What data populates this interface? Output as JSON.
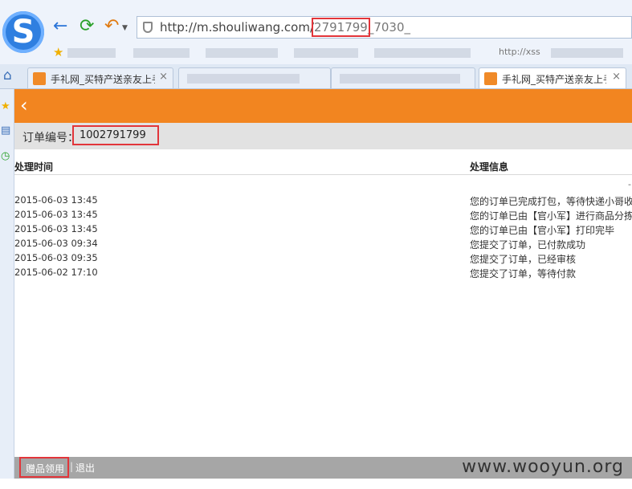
{
  "browser": {
    "logo_letter": "S",
    "icons": {
      "back": "back-arrow-icon",
      "refresh": "refresh-icon",
      "undo": "undo-icon"
    },
    "url_prefix": "http://",
    "url_host": "m.shouliwang.com/",
    "url_highlight": "2791799",
    "url_suffix": "_7030_",
    "bookmark_text": "http://xss",
    "tabs": [
      {
        "label": "手礼网_买特产送亲友上手",
        "close": "×"
      },
      {
        "label": "",
        "close": ""
      },
      {
        "label": "",
        "close": ""
      },
      {
        "label": "手礼网_买特产送亲友上手",
        "close": "×"
      }
    ]
  },
  "page": {
    "header_back": "‹",
    "order_label": "订单编号：",
    "order_number": "1002791799",
    "columns": {
      "time": "处理时间",
      "info": "处理信息"
    },
    "dash": "-",
    "rows": [
      {
        "time": "2015-06-03 13:45",
        "info": "您的订单已完成打包，等待快递小哥收"
      },
      {
        "time": "2015-06-03 13:45",
        "info": "您的订单已由【官小军】进行商品分拣"
      },
      {
        "time": "2015-06-03 13:45",
        "info": "您的订单已由【官小军】打印完毕"
      },
      {
        "time": "2015-06-03 09:34",
        "info": "您提交了订单，已付款成功"
      },
      {
        "time": "2015-06-03 09:35",
        "info": "您提交了订单，已经审核"
      },
      {
        "time": "2015-06-02 17:10",
        "info": "您提交了订单，等待付款"
      }
    ]
  },
  "footer": {
    "gift": "赠品领用",
    "separator": "|",
    "logout": "退出",
    "watermark": "www.wooyun.org"
  },
  "colors": {
    "header_orange": "#f28520",
    "highlight_red": "#e2353a",
    "footer_gray": "#a6a6a6"
  }
}
